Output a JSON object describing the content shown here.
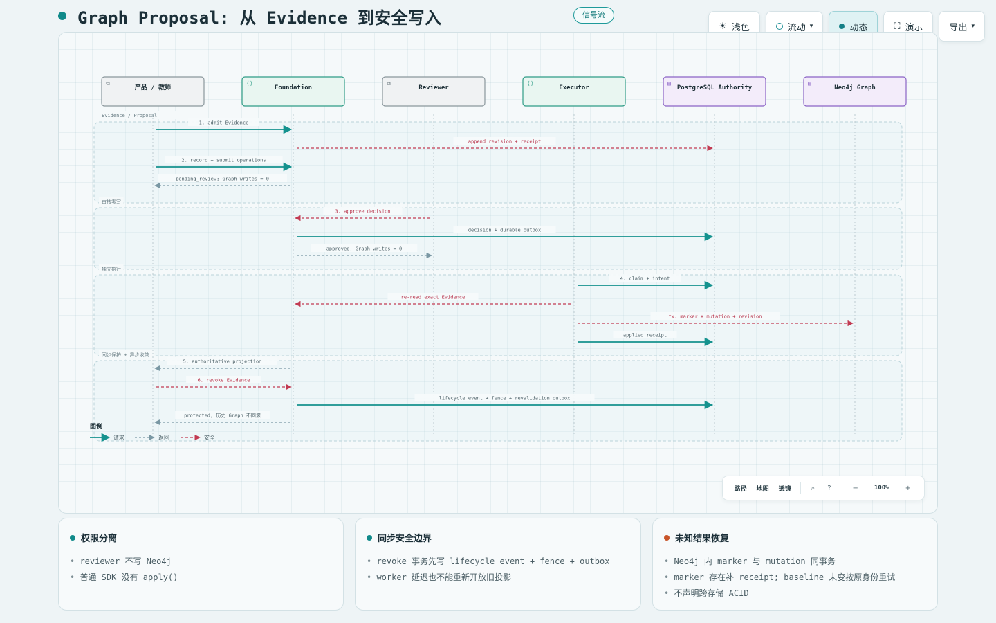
{
  "header": {
    "title": "Graph Proposal: 从 Evidence 到安全写入",
    "pill": "信号流"
  },
  "toolbar": {
    "theme": "浅色",
    "flow": "流动",
    "dynamic": "动态",
    "present": "演示",
    "export": "导出"
  },
  "diagram": {
    "participants": [
      {
        "name": "产品 / 教师",
        "kind": "actor"
      },
      {
        "name": "Foundation",
        "kind": "service"
      },
      {
        "name": "Reviewer",
        "kind": "actor"
      },
      {
        "name": "Executor",
        "kind": "service"
      },
      {
        "name": "PostgreSQL Authority",
        "kind": "store"
      },
      {
        "name": "Neo4j Graph",
        "kind": "store"
      }
    ],
    "groups": [
      "Evidence / Proposal",
      "审核零写",
      "独立执行",
      "同步保护 + 异步收敛"
    ],
    "messages": [
      {
        "from": 0,
        "to": 1,
        "label": "1. admit Evidence",
        "style": "request",
        "group": 0
      },
      {
        "from": 1,
        "to": 4,
        "label": "append revision + receipt",
        "style": "safety",
        "group": 0
      },
      {
        "from": 0,
        "to": 1,
        "label": "2. record + submit operations",
        "style": "request",
        "group": 0
      },
      {
        "from": 1,
        "to": 0,
        "label": "pending_review; Graph writes = 0",
        "style": "return",
        "group": 0
      },
      {
        "from": 2,
        "to": 1,
        "label": "3. approve decision",
        "style": "safety",
        "group": 1
      },
      {
        "from": 1,
        "to": 4,
        "label": "decision + durable outbox",
        "style": "request",
        "group": 1
      },
      {
        "from": 1,
        "to": 2,
        "label": "approved; Graph writes = 0",
        "style": "return",
        "group": 1
      },
      {
        "from": 3,
        "to": 4,
        "label": "4. claim + intent",
        "style": "request",
        "group": 2
      },
      {
        "from": 3,
        "to": 1,
        "label": "re-read exact Evidence",
        "style": "safety",
        "group": 2
      },
      {
        "from": 3,
        "to": 5,
        "label": "tx: marker + mutation + revision",
        "style": "safety",
        "group": 2
      },
      {
        "from": 3,
        "to": 4,
        "label": "applied receipt",
        "style": "request",
        "group": 2
      },
      {
        "from": 1,
        "to": 0,
        "label": "5. authoritative projection",
        "style": "return",
        "group": 3
      },
      {
        "from": 0,
        "to": 1,
        "label": "6. revoke Evidence",
        "style": "safety",
        "group": 3
      },
      {
        "from": 1,
        "to": 4,
        "label": "lifecycle event + fence + revalidation outbox",
        "style": "request",
        "group": 3
      },
      {
        "from": 1,
        "to": 0,
        "label": "protected; 历史 Graph 不回滚",
        "style": "return",
        "group": 3
      }
    ],
    "legend": {
      "title": "图例",
      "request": "请求",
      "return": "返回",
      "safety": "安全"
    },
    "colors": {
      "request": "#14928e",
      "return": "#7a98a4",
      "safety": "#c23a52",
      "actor_bg": "#f0f2f3",
      "service_bg": "#e9f6f1",
      "store_bg": "#f3ecfa"
    }
  },
  "zoom": {
    "path": "路径",
    "map": "地图",
    "lens": "透镜",
    "minus": "−",
    "value": "100%",
    "plus": "+"
  },
  "cards": [
    {
      "title": "权限分离",
      "color": "#118a8a",
      "items": [
        "reviewer 不写 Neo4j",
        "普通 SDK 没有 apply()"
      ]
    },
    {
      "title": "同步安全边界",
      "color": "#118a8a",
      "items": [
        "revoke 事务先写 lifecycle event + fence + outbox",
        "worker 延迟也不能重新开放旧投影"
      ]
    },
    {
      "title": "未知结果恢复",
      "color": "#c8552a",
      "items": [
        "Neo4j 内 marker 与 mutation 同事务",
        "marker 存在补 receipt; baseline 未变按原身份重试",
        "不声明跨存储 ACID"
      ]
    }
  ]
}
